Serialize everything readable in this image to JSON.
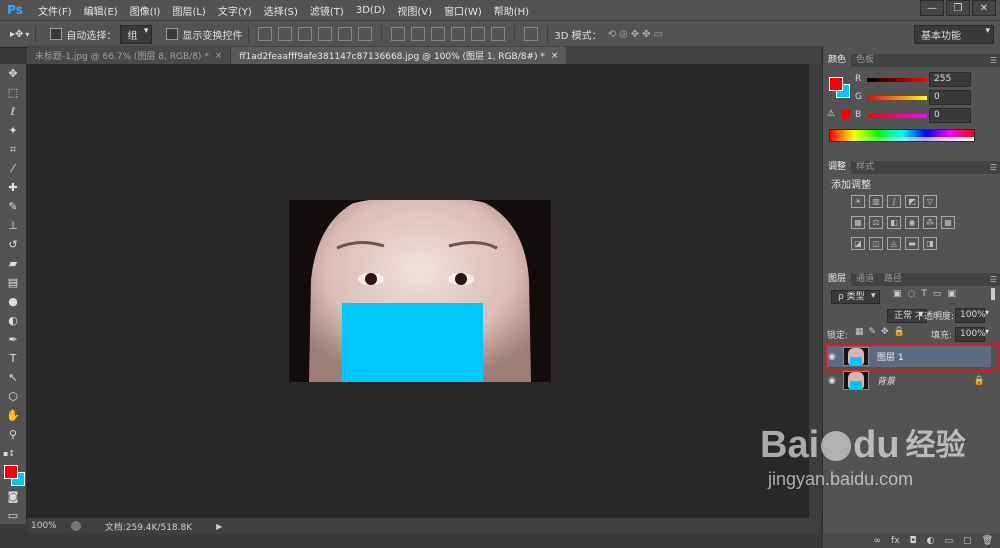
{
  "app": {
    "logo": "Ps"
  },
  "menubar": {
    "items": [
      "文件(F)",
      "编辑(E)",
      "图像(I)",
      "图层(L)",
      "文字(Y)",
      "选择(S)",
      "滤镜(T)",
      "3D(D)",
      "视图(V)",
      "窗口(W)",
      "帮助(H)"
    ]
  },
  "window_controls": [
    "—",
    "❐",
    "✕"
  ],
  "optionsbar": {
    "auto_select_label": "自动选择：",
    "auto_select_value": "组",
    "show_transform_label": "显示变换控件",
    "mode3d_label": "3D 模式：",
    "workspace": "基本功能"
  },
  "tabs": [
    {
      "label": "未标题-1.jpg @ 66.7% (图层 8, RGB/8) *",
      "close": "×"
    },
    {
      "label": "ff1ad2feaafff9afe381147c87136668.jpg @ 100% (图层 1, RGB/8#) *",
      "close": "×"
    }
  ],
  "statusbar": {
    "zoom": "100%",
    "doc": "文档:259.4K/518.8K"
  },
  "color_panel": {
    "tabs": [
      "颜色",
      "色板"
    ],
    "channels": [
      {
        "label": "R",
        "value": "255",
        "color": "#ff0000"
      },
      {
        "label": "G",
        "value": "0",
        "color": "#ffff00"
      },
      {
        "label": "B",
        "value": "0",
        "color": "#ff00ff"
      }
    ],
    "fg_color": "#ff0000",
    "bg_color": "#00c8ff"
  },
  "adjust_panel": {
    "tabs": [
      "调整",
      "样式"
    ],
    "title": "添加调整"
  },
  "layers_panel": {
    "tabs": [
      "图层",
      "通道",
      "路径"
    ],
    "filter": "ρ 类型",
    "blend_mode": "正常",
    "opacity_label": "不透明度:",
    "opacity": "100%",
    "lock_label": "锁定:",
    "fill_label": "填充:",
    "fill": "100%",
    "layers": [
      {
        "name": "图层 1",
        "selected": true
      },
      {
        "name": "背景",
        "selected": false,
        "italic": true
      }
    ],
    "highlight_color": "#e31818"
  },
  "watermark": {
    "brand": "Bai",
    "brand_suffix": "du",
    "cn": "经验",
    "url": "jingyan.baidu.com"
  },
  "image": {
    "overlay_color": "#00c8ff"
  }
}
